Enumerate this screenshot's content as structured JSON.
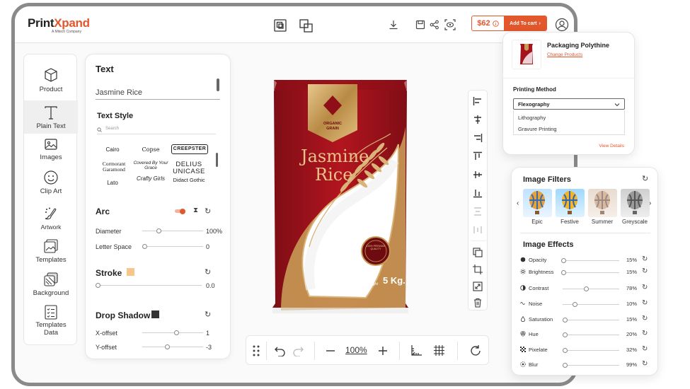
{
  "brand": {
    "name_part1": "Print",
    "name_part2": "Xpand",
    "tagline": "A Mitech Company"
  },
  "header": {
    "price": "$62",
    "add_to_cart": "Add To cart"
  },
  "sidebar": {
    "items": [
      {
        "label": "Product",
        "icon": "cube-icon"
      },
      {
        "label": "Plain Text",
        "icon": "text-icon"
      },
      {
        "label": "Images",
        "icon": "image-icon"
      },
      {
        "label": "Clip Art",
        "icon": "smiley-icon"
      },
      {
        "label": "Artwork",
        "icon": "palette-icon"
      },
      {
        "label": "Templates",
        "icon": "templates-icon"
      },
      {
        "label": "Background",
        "icon": "layers-icon"
      },
      {
        "label": "Templates Data",
        "icon": "checklist-icon"
      }
    ]
  },
  "text_panel": {
    "title": "Text",
    "text_value": "Jasmine Rice",
    "text_style_title": "Text Style",
    "search_placeholder": "Search",
    "fonts": [
      "Cairo",
      "Copse",
      "CREEPSTER",
      "Cormorant Garamond",
      "Covered By Your Grace",
      "DELIUS UNICASE",
      "Lato",
      "Crafty Girls",
      "Didact Gothic"
    ],
    "arc_title": "Arc",
    "diameter_label": "Diameter",
    "diameter_value": "100%",
    "letter_space_label": "Letter Space",
    "letter_space_value": "0",
    "stroke_title": "Stroke",
    "stroke_value": "0.0",
    "stroke_color": "#f6c68a",
    "drop_shadow_title": "Drop Shadow",
    "drop_shadow_color": "#333333",
    "x_offset_label": "X-offset",
    "x_offset_value": "1",
    "y_offset_label": "Y-offset",
    "y_offset_value": "-3"
  },
  "product_image": {
    "brand_line1": "ORGANIC",
    "brand_line2": "GRAIN",
    "title_line1": "Jasmine",
    "title_line2": "Rice",
    "net_weight_label": "Net Weight",
    "net_weight_value": "5 Kg.",
    "seal_text": "100% PREMIUM QUALITY"
  },
  "zoom": {
    "value": "100%"
  },
  "product_card": {
    "name": "Packaging Polythine",
    "change_link": "Change Products",
    "printing_method_label": "Printing Method",
    "selected_method": "Flexography",
    "options": [
      "Lithography",
      "Gravure Printing"
    ],
    "view_details": "View Details"
  },
  "filters": {
    "title": "Image Filters",
    "items": [
      "Epic",
      "Festive",
      "Summer",
      "Greyscale"
    ]
  },
  "effects": {
    "title": "Image Effects",
    "rows": [
      {
        "name": "Opacity",
        "value": "15%"
      },
      {
        "name": "Brightness",
        "value": "15%"
      },
      {
        "name": "Contrast",
        "value": "78%"
      },
      {
        "name": "Noise",
        "value": "10%"
      },
      {
        "name": "Saturation",
        "value": "15%"
      },
      {
        "name": "Hue",
        "value": "20%"
      },
      {
        "name": "Pixelate",
        "value": "32%"
      },
      {
        "name": "Blur",
        "value": "99%"
      }
    ]
  },
  "colors": {
    "accent": "#e2572b",
    "bag_red": "#a5131d",
    "gold": "#c89a55"
  }
}
